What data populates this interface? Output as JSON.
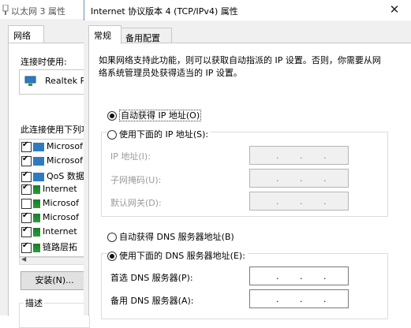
{
  "background_window": {
    "title": "以太网 3 属性",
    "tab": "网络",
    "connect_using_label": "连接时使用:",
    "adapter_name": "Realtek P",
    "components_label": "此连接使用下列项",
    "components": [
      {
        "label": "Microsof",
        "checked": true
      },
      {
        "label": "Microsof",
        "checked": true
      },
      {
        "label": "QoS 数据",
        "checked": true
      },
      {
        "label": "Internet ",
        "checked": true
      },
      {
        "label": "Microsof",
        "checked": false
      },
      {
        "label": "Microsof",
        "checked": true
      },
      {
        "label": "Internet ",
        "checked": true
      },
      {
        "label": "链路层拓",
        "checked": true
      }
    ],
    "install_button": "安装(N)...",
    "description_label": "描述"
  },
  "dialog": {
    "title": "Internet 协议版本 4 (TCP/IPv4) 属性",
    "close_label": "✕",
    "tabs": [
      "常规",
      "备用配置"
    ],
    "intro_line1": "如果网络支持此功能，则可以获取自动指派的 IP 设置。否则，你需要从网",
    "intro_line2": "络系统管理员处获得适当的 IP 设置。",
    "ip_auto_label": "自动获得 IP 地址(O)",
    "ip_manual_label": "使用下面的 IP 地址(S):",
    "ip_address_label": "IP 地址(I):",
    "subnet_label": "子网掩码(U):",
    "gateway_label": "默认网关(D):",
    "dns_auto_label": "自动获得 DNS 服务器地址(B)",
    "dns_manual_label": "使用下面的 DNS 服务器地址(E):",
    "preferred_dns_label": "首选 DNS 服务器(P):",
    "alternate_dns_label": "备用 DNS 服务器(A):",
    "ip_selected": "auto",
    "dns_selected": "manual"
  },
  "colors": {
    "window_bg": "#f0f0f0",
    "page_bg": "#ffffff",
    "disabled_text": "#9a9a9a"
  }
}
